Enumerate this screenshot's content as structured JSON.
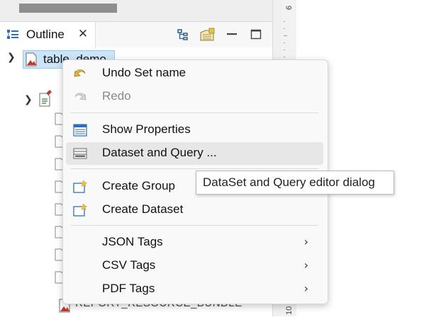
{
  "outline_panel": {
    "tab_title": "Outline",
    "close_glyph": "✕",
    "tree": {
      "root_label": "table_demo",
      "bottom_label": "REPORT_RESOURCE_BUNDLE"
    }
  },
  "ruler": {
    "top_label": "6",
    "bottom_label": "10"
  },
  "context_menu": {
    "items": [
      {
        "label": "Undo Set name",
        "icon": "undo-icon",
        "enabled": true
      },
      {
        "label": "Redo",
        "icon": "redo-icon",
        "enabled": false
      },
      {
        "label": "Show Properties",
        "icon": "properties-icon",
        "enabled": true
      },
      {
        "label": "Dataset and Query ...",
        "icon": "dataset-query-icon",
        "enabled": true,
        "highlighted": true
      },
      {
        "label": "Create Group",
        "icon": "create-group-icon",
        "enabled": true
      },
      {
        "label": "Create Dataset",
        "icon": "create-dataset-icon",
        "enabled": true
      },
      {
        "label": "JSON Tags",
        "icon": "",
        "enabled": true,
        "submenu": true
      },
      {
        "label": "CSV Tags",
        "icon": "",
        "enabled": true,
        "submenu": true
      },
      {
        "label": "PDF Tags",
        "icon": "",
        "enabled": true,
        "submenu": true
      }
    ],
    "submenu_glyph": "›"
  },
  "tooltip": {
    "text": "DataSet and Query editor dialog"
  },
  "colors": {
    "selection_bg": "#cce4f7",
    "menu_bg": "#f9f9f9",
    "highlight_bg": "#e7e7e7",
    "accent_blue": "#1f6fb5"
  }
}
